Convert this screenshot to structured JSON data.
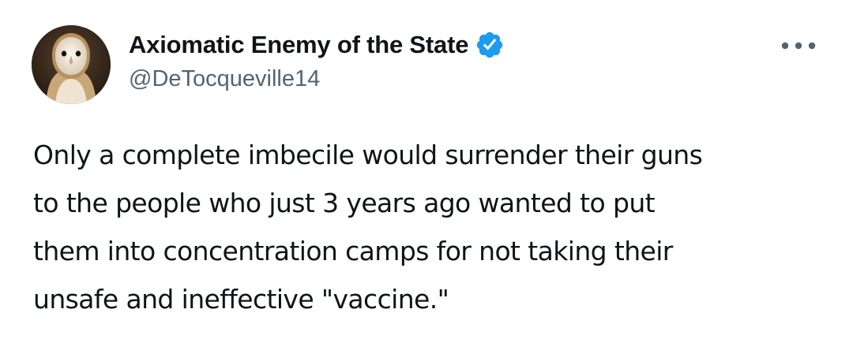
{
  "author": {
    "display_name": "Axiomatic Enemy of the State",
    "handle": "@DeTocqueville14",
    "verified": true,
    "avatar_icon": "barn-owl-avatar"
  },
  "menu": {
    "icon": "more-horizontal-icon",
    "glyph": "•••"
  },
  "tweet": {
    "text": "Only a complete imbecile would surrender their guns\nto the people who just 3 years ago wanted to put\nthem into concentration camps for not taking their\nunsafe and ineffective \"vaccine.\""
  },
  "colors": {
    "text_primary": "#0f1419",
    "text_secondary": "#536471",
    "verified_blue": "#1d9bf0",
    "background": "#ffffff"
  }
}
